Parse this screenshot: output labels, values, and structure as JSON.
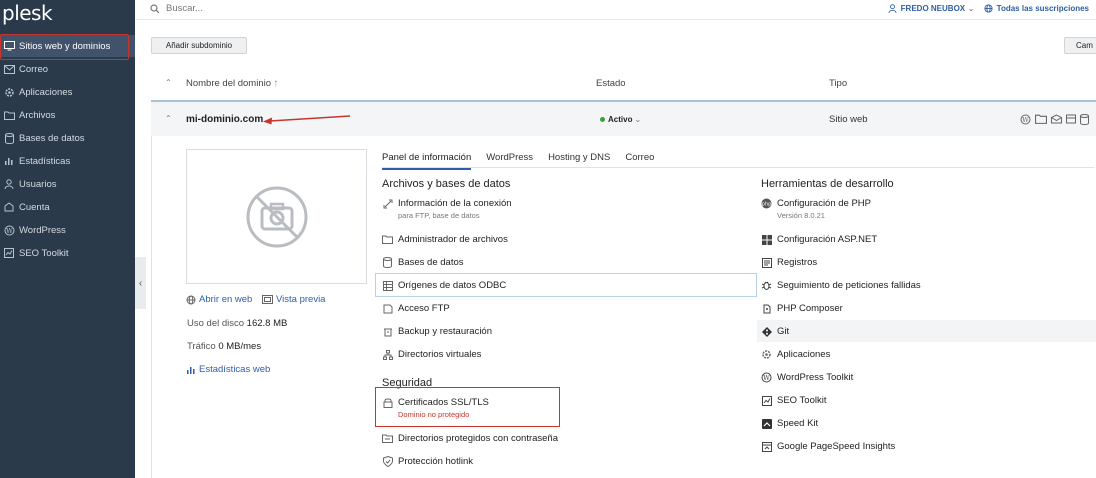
{
  "app": {
    "logo": "plesk"
  },
  "sidebar": {
    "items": [
      {
        "label": "Sitios web y dominios",
        "icon": "monitor-icon",
        "active": true
      },
      {
        "label": "Correo",
        "icon": "mail-icon"
      },
      {
        "label": "Aplicaciones",
        "icon": "gear-icon"
      },
      {
        "label": "Archivos",
        "icon": "folder-icon"
      },
      {
        "label": "Bases de datos",
        "icon": "database-icon"
      },
      {
        "label": "Estadísticas",
        "icon": "bar-chart-icon"
      },
      {
        "label": "Usuarios",
        "icon": "user-icon"
      },
      {
        "label": "Cuenta",
        "icon": "account-icon"
      },
      {
        "label": "WordPress",
        "icon": "wordpress-icon"
      },
      {
        "label": "SEO Toolkit",
        "icon": "seo-icon"
      }
    ]
  },
  "topbar": {
    "search_placeholder": "Buscar...",
    "user_name": "FREDO NEUBOX",
    "subscriptions": "Todas las suscripciones"
  },
  "toolbar": {
    "add_subdomain": "Añadir subdominio",
    "right_button": "Cam"
  },
  "table": {
    "headers": {
      "name": "Nombre del dominio",
      "status": "Estado",
      "type": "Tipo"
    },
    "row": {
      "domain": "mi-dominio.com",
      "status": "Activo",
      "type": "Sitio web"
    }
  },
  "panel": {
    "open_web": "Abrir en web",
    "preview": "Vista previa",
    "disk_label": "Uso del disco",
    "disk_value": "162.8 MB",
    "traffic_label": "Tráfico",
    "traffic_value": "0 MB/mes",
    "stats": "Estadísticas web",
    "tabs": [
      "Panel de información",
      "WordPress",
      "Hosting y DNS",
      "Correo"
    ],
    "files_title": "Archivos y bases de datos",
    "files_items": [
      {
        "label": "Información de la conexión",
        "sub": "para FTP, base de datos",
        "icon": "connection-icon"
      },
      {
        "label": "Administrador de archivos",
        "icon": "folder-icon"
      },
      {
        "label": "Bases de datos",
        "icon": "database-icon"
      },
      {
        "label": "Orígenes de datos ODBC",
        "icon": "odbc-icon"
      },
      {
        "label": "Acceso FTP",
        "icon": "ftp-icon"
      },
      {
        "label": "Backup y restauración",
        "icon": "backup-icon"
      },
      {
        "label": "Directorios virtuales",
        "icon": "sitemap-icon"
      }
    ],
    "security_title": "Seguridad",
    "security_items": [
      {
        "label": "Certificados SSL/TLS",
        "sub": "Dominio no protegido",
        "icon": "certificate-icon"
      },
      {
        "label": "Directorios protegidos con contraseña",
        "icon": "protected-folder-icon"
      },
      {
        "label": "Protección hotlink",
        "icon": "shield-icon"
      }
    ],
    "dev_title": "Herramientas de desarrollo",
    "dev_items": [
      {
        "label": "Configuración de PHP",
        "sub": "Versión 8.0.21",
        "icon": "php-icon"
      },
      {
        "label": "Configuración ASP.NET",
        "icon": "windows-icon"
      },
      {
        "label": "Registros",
        "icon": "logs-icon"
      },
      {
        "label": "Seguimiento de peticiones fallidas",
        "icon": "bug-icon"
      },
      {
        "label": "PHP Composer",
        "icon": "composer-icon"
      },
      {
        "label": "Git",
        "icon": "git-icon"
      },
      {
        "label": "Aplicaciones",
        "icon": "gear-icon"
      },
      {
        "label": "WordPress Toolkit",
        "icon": "wordpress-icon"
      },
      {
        "label": "SEO Toolkit",
        "icon": "seo-icon"
      },
      {
        "label": "Speed Kit",
        "icon": "speed-icon"
      },
      {
        "label": "Google PageSpeed Insights",
        "icon": "pagespeed-icon"
      }
    ]
  },
  "colors": {
    "sidebar_bg": "#2b3a4a",
    "accent": "#2f5ea6",
    "active_status": "#3ca03c",
    "warning": "#c8352c"
  }
}
